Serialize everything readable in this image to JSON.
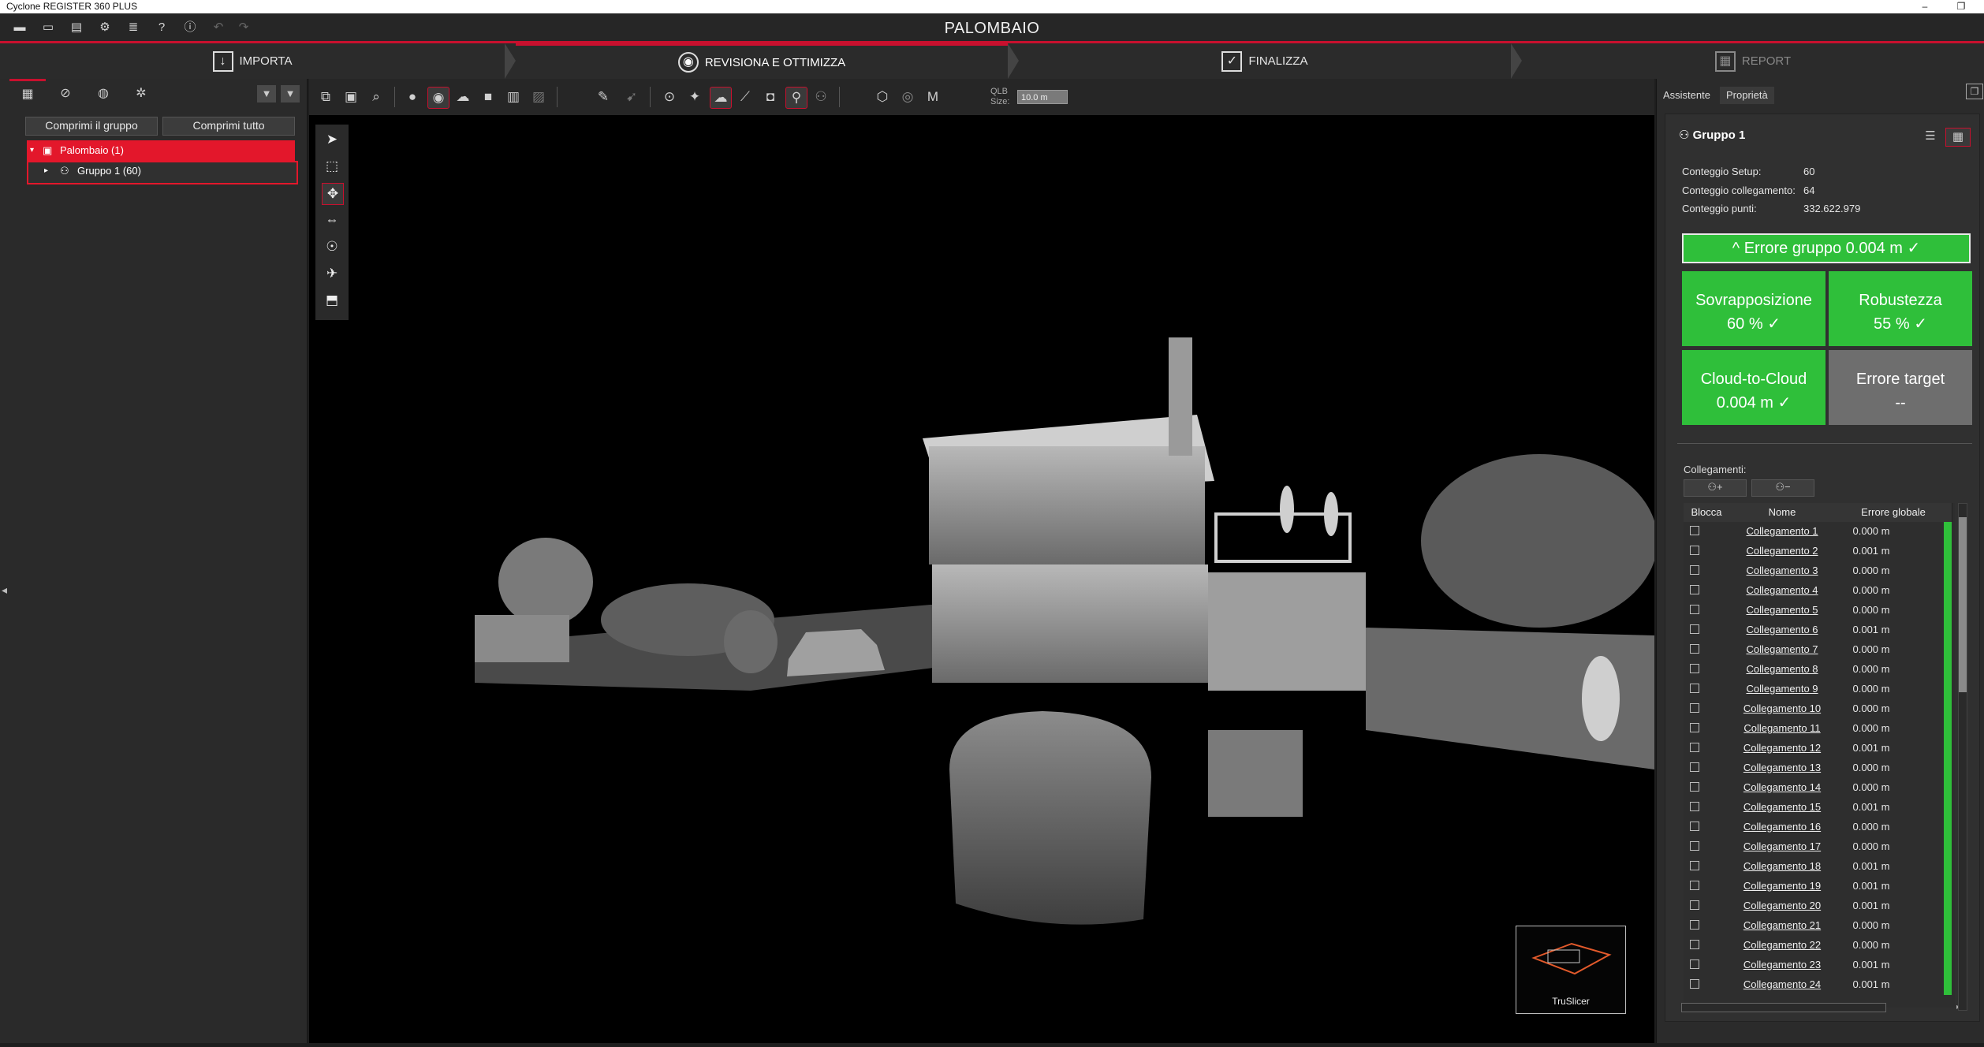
{
  "app": {
    "title": "Cyclone REGISTER 360 PLUS"
  },
  "window_controls": {
    "minimize": "–",
    "maximize": "❐"
  },
  "project": {
    "name": "PALOMBAIO"
  },
  "workflow_steps": [
    {
      "label": "IMPORTA",
      "icon": "import-icon"
    },
    {
      "label": "REVISIONA E OTTIMIZZA",
      "icon": "review-icon",
      "active": true
    },
    {
      "label": "FINALIZZA",
      "icon": "finalize-icon"
    },
    {
      "label": "REPORT",
      "icon": "report-icon"
    }
  ],
  "left_panel": {
    "collapse_group_button": "Comprimi il gruppo",
    "collapse_all_button": "Comprimi tutto",
    "tree": [
      {
        "label": "Palombaio (1)"
      },
      {
        "label": "Gruppo 1 (60)"
      }
    ]
  },
  "viewer_toolbar": {
    "qlb_label_line1": "QLB",
    "qlb_label_line2": "Size:",
    "qlb_value": "10.0 m"
  },
  "truslicer": {
    "label": "TruSlicer"
  },
  "right_panel": {
    "tabs": [
      "Assistente",
      "Proprietà"
    ],
    "group_title": "Gruppo 1",
    "stats": [
      {
        "label": "Conteggio Setup:",
        "value": "60"
      },
      {
        "label": "Conteggio collegamento:",
        "value": "64"
      },
      {
        "label": "Conteggio punti:",
        "value": "332.622.979"
      }
    ],
    "group_error": "^ Errore gruppo 0.004 m   ✓",
    "tiles": [
      {
        "title": "Sovrapposizione",
        "value": "60 %   ✓",
        "color": "#2fbf3a"
      },
      {
        "title": "Robustezza",
        "value": "55 %   ✓",
        "color": "#2fbf3a"
      },
      {
        "title": "Cloud-to-Cloud",
        "value": "0.004 m   ✓",
        "color": "#2fbf3a"
      },
      {
        "title": "Errore target",
        "value": "--",
        "color": "#6e6e6e"
      }
    ],
    "links_label": "Collegamenti:",
    "table_headers": [
      "Blocca",
      "Nome",
      "Errore globale"
    ],
    "links": [
      {
        "name": "Collegamento 1",
        "error": "0.000 m"
      },
      {
        "name": "Collegamento 2",
        "error": "0.001 m"
      },
      {
        "name": "Collegamento 3",
        "error": "0.000 m"
      },
      {
        "name": "Collegamento 4",
        "error": "0.000 m"
      },
      {
        "name": "Collegamento 5",
        "error": "0.000 m"
      },
      {
        "name": "Collegamento 6",
        "error": "0.001 m"
      },
      {
        "name": "Collegamento 7",
        "error": "0.000 m"
      },
      {
        "name": "Collegamento 8",
        "error": "0.000 m"
      },
      {
        "name": "Collegamento 9",
        "error": "0.000 m"
      },
      {
        "name": "Collegamento 10",
        "error": "0.000 m"
      },
      {
        "name": "Collegamento 11",
        "error": "0.000 m"
      },
      {
        "name": "Collegamento 12",
        "error": "0.001 m"
      },
      {
        "name": "Collegamento 13",
        "error": "0.000 m"
      },
      {
        "name": "Collegamento 14",
        "error": "0.000 m"
      },
      {
        "name": "Collegamento 15",
        "error": "0.001 m"
      },
      {
        "name": "Collegamento 16",
        "error": "0.000 m"
      },
      {
        "name": "Collegamento 17",
        "error": "0.000 m"
      },
      {
        "name": "Collegamento 18",
        "error": "0.001 m"
      },
      {
        "name": "Collegamento 19",
        "error": "0.001 m"
      },
      {
        "name": "Collegamento 20",
        "error": "0.001 m"
      },
      {
        "name": "Collegamento 21",
        "error": "0.000 m"
      },
      {
        "name": "Collegamento 22",
        "error": "0.000 m"
      },
      {
        "name": "Collegamento 23",
        "error": "0.001 m"
      },
      {
        "name": "Collegamento 24",
        "error": "0.001 m"
      }
    ]
  },
  "colors": {
    "accent": "#c8102e",
    "selection": "#e3172b",
    "success": "#2fbf3a"
  }
}
